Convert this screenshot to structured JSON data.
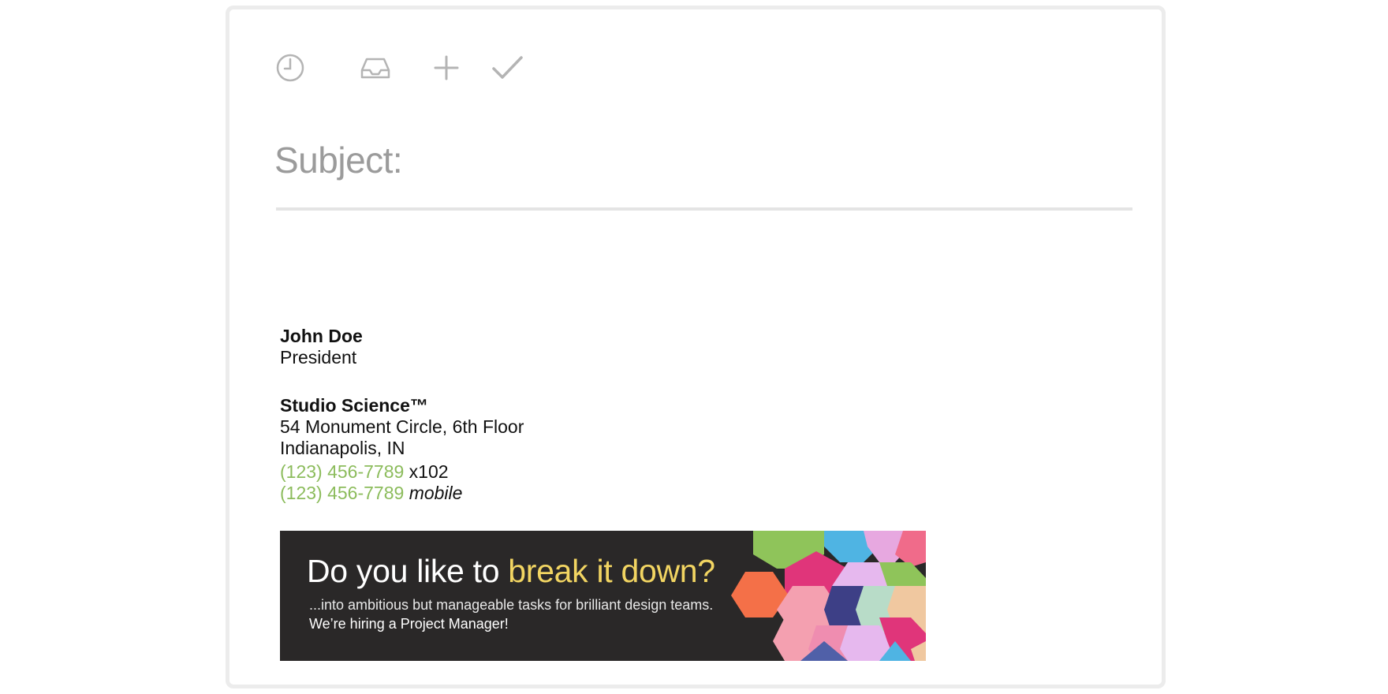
{
  "compose": {
    "toolbar": {
      "icons": [
        "clock-icon",
        "inbox-icon",
        "plus-icon",
        "check-icon"
      ],
      "icon_color": "#b4b4b4"
    },
    "subject_label": "Subject:"
  },
  "signature": {
    "name": "John Doe",
    "title": "President",
    "company": "Studio Science™",
    "address_line1": "54 Monument Circle, 6th Floor",
    "address_line2": "Indianapolis, IN",
    "phones": [
      {
        "number": "(123) 456-7789",
        "suffix": " x102"
      },
      {
        "number": "(123) 456-7789",
        "suffix": "mobile"
      }
    ],
    "phone_color": "#8cbc5c"
  },
  "banner": {
    "headline_plain": "Do you like to ",
    "headline_highlight": "break it down?",
    "subline": "...into ambitious but manageable tasks for brilliant design teams.",
    "hiring": "We’re hiring a Project Manager!",
    "background": "#2a2828",
    "highlight_color": "#f2d562"
  }
}
